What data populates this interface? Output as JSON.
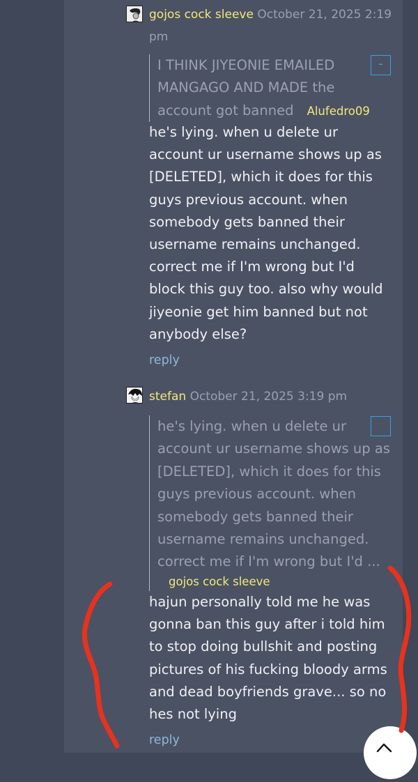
{
  "comments": [
    {
      "author": "gojos cock sleeve",
      "date": "October 21, 2025 2:19 pm",
      "avatar_icon": "avatar-sketch-icon",
      "quote": {
        "text": "I THINK JIYEONIE EMAILED MANGAGO AND MADE the account got banned",
        "author": "Alufedro09",
        "toggle_label": "-"
      },
      "body": "he's lying. when u delete ur account ur username shows up as [DELETED], which it does for this guys previous account. when somebody gets banned their username remains unchanged. correct me if I'm wrong but I'd block this guy too. also why would jiyeonie get him banned but not anybody else?",
      "reply_label": "reply"
    },
    {
      "author": "stefan",
      "date": "October 21, 2025 3:19 pm",
      "avatar_icon": "avatar-anime-icon",
      "quote": {
        "text": "he's lying. when u delete ur account ur username shows up as [DELETED], which it does for this guys previous account. when somebody gets banned their username remains unchanged. correct me if I'm wrong but I'd ...",
        "author": "gojos cock sleeve",
        "toggle_label": "+"
      },
      "body": "hajun personally told me he was gonna ban this guy after i told him to stop doing bullshit and posting pictures of his fucking bloody arms and dead boyfriends grave... so no hes not lying",
      "reply_label": "reply"
    }
  ],
  "scroll_top_icon": "chevron-up-icon",
  "colors": {
    "background": "#3f4758",
    "panel": "#4b5264",
    "author": "#f3e878",
    "date": "#9aa1ad",
    "body": "#f0f1f3",
    "quote": "#9ba1ad",
    "reply": "#8fb7d9",
    "toggle": "#3aa0e0",
    "annotation": "#e8321e"
  },
  "annotation": "red hand-drawn brackets around the second comment body"
}
